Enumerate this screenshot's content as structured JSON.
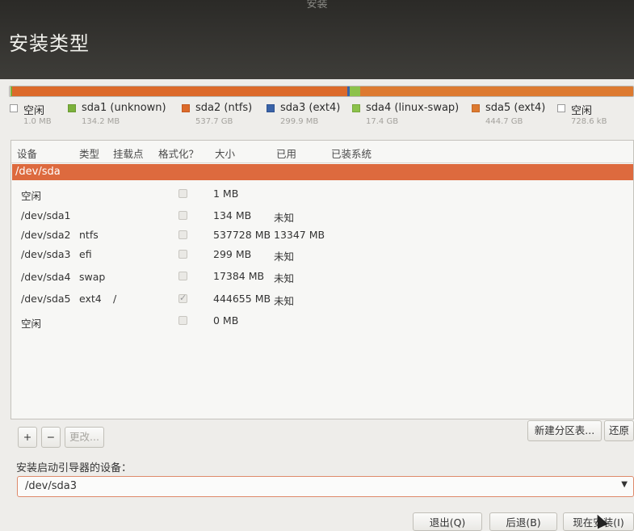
{
  "window": {
    "title": "安装"
  },
  "header": {
    "title": "安装类型"
  },
  "colors": {
    "free": "#ffffff",
    "sda1": "#7bb13b",
    "sda2": "#dc6a2a",
    "sda3": "#3a63a8",
    "sda4": "#8cc24a",
    "sda5": "#dd7a30",
    "selection": "#dd6a3e"
  },
  "partition_bar": {
    "segments": [
      {
        "id": "free1",
        "size_mb": 1
      },
      {
        "id": "sda1",
        "size_mb": 134.2
      },
      {
        "id": "sda2",
        "size_mb": 537728
      },
      {
        "id": "sda3",
        "size_mb": 299.9
      },
      {
        "id": "sda4",
        "size_mb": 17384
      },
      {
        "id": "sda5",
        "size_mb": 444655
      },
      {
        "id": "free2",
        "size_mb": 0.7
      }
    ]
  },
  "legend": [
    {
      "name": "空闲",
      "size": "1.0 MB",
      "color_key": "free"
    },
    {
      "name": "sda1 (unknown)",
      "size": "134.2 MB",
      "color_key": "sda1"
    },
    {
      "name": "sda2 (ntfs)",
      "size": "537.7 GB",
      "color_key": "sda2"
    },
    {
      "name": "sda3 (ext4)",
      "size": "299.9 MB",
      "color_key": "sda3"
    },
    {
      "name": "sda4 (linux-swap)",
      "size": "17.4 GB",
      "color_key": "sda4"
    },
    {
      "name": "sda5 (ext4)",
      "size": "444.7 GB",
      "color_key": "sda5"
    },
    {
      "name": "空闲",
      "size": "728.6 kB",
      "color_key": "free"
    }
  ],
  "table": {
    "columns": [
      "设备",
      "类型",
      "挂载点",
      "格式化？",
      "大小",
      "已用",
      "已装系统"
    ],
    "selected_device": "/dev/sda",
    "rows": [
      {
        "device": "空闲",
        "type": "",
        "mount": "",
        "format": false,
        "size": "1 MB",
        "used": ""
      },
      {
        "device": "/dev/sda1",
        "type": "",
        "mount": "",
        "format": false,
        "size": "134 MB",
        "used": "未知"
      },
      {
        "device": "/dev/sda2",
        "type": "ntfs",
        "mount": "",
        "format": false,
        "size": "537728 MB",
        "used": "13347 MB"
      },
      {
        "device": "/dev/sda3",
        "type": "efi",
        "mount": "",
        "format": false,
        "size": "299 MB",
        "used": "未知"
      },
      {
        "device": "/dev/sda4",
        "type": "swap",
        "mount": "",
        "format": false,
        "size": "17384 MB",
        "used": "未知"
      },
      {
        "device": "/dev/sda5",
        "type": "ext4",
        "mount": "/",
        "format": true,
        "size": "444655 MB",
        "used": "未知"
      },
      {
        "device": "空闲",
        "type": "",
        "mount": "",
        "format": false,
        "size": "0 MB",
        "used": ""
      }
    ]
  },
  "toolbar": {
    "add_label": "+",
    "remove_label": "−",
    "change_label": "更改...",
    "new_table_label": "新建分区表...",
    "revert_label": "还原"
  },
  "boot_loader": {
    "label": "安装启动引导器的设备：",
    "value": "/dev/sda3"
  },
  "footer": {
    "quit_label": "退出(Q)",
    "back_label": "后退(B)",
    "install_label": "现在安装(I)"
  }
}
